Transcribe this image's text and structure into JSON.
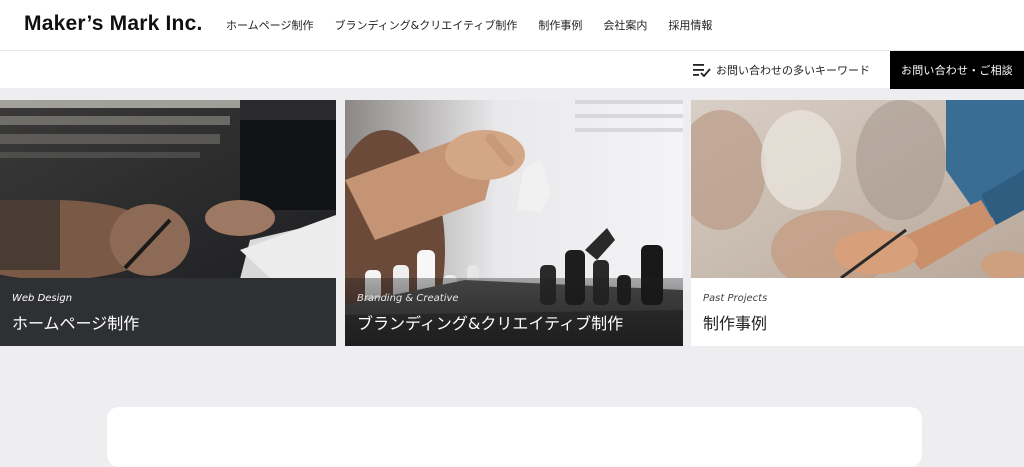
{
  "header": {
    "logo": "Maker’s Mark Inc.",
    "nav": [
      {
        "label": "ホームページ制作"
      },
      {
        "label": "ブランディング&クリエイティブ制作"
      },
      {
        "label": "制作事例"
      },
      {
        "label": "会社案内"
      },
      {
        "label": "採用情報"
      }
    ]
  },
  "subbar": {
    "keyword_link": "お問い合わせの多いキーワード",
    "keyword_icon": "checklist-icon",
    "contact_button": "お問い合わせ・ご相談"
  },
  "cards": [
    {
      "en": "Web Design",
      "ja": "ホームページ制作"
    },
    {
      "en": "Branding & Creative",
      "ja": "ブランディング&クリエイティブ制作"
    },
    {
      "en": "Past Projects",
      "ja": "制作事例"
    }
  ],
  "colors": {
    "background": "#eeeef1",
    "contact_button_bg": "#000000",
    "card1_caption_bg": "#2f3034",
    "card3_caption_bg": "#ffffff"
  }
}
